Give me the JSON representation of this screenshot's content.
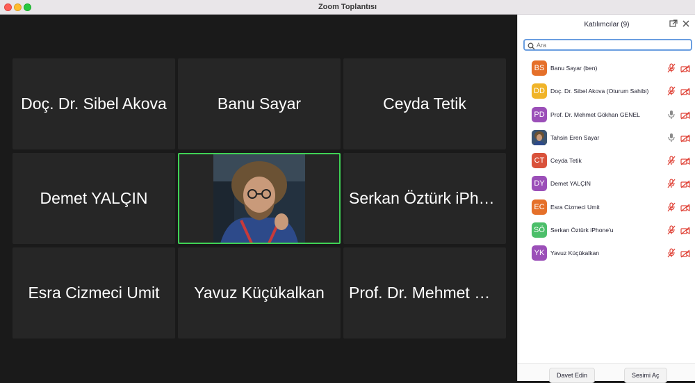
{
  "window": {
    "title": "Zoom Toplantısı"
  },
  "gallery": {
    "tiles": [
      {
        "name": "Doç. Dr. Sibel Akova"
      },
      {
        "name": "Banu Sayar"
      },
      {
        "name": "Ceyda Tetik"
      },
      {
        "name": "Demet YALÇIN"
      },
      {
        "name": "Tahsin Eren Sayar",
        "video": true,
        "active": true
      },
      {
        "name": "Serkan Öztürk iPhone'u"
      },
      {
        "name": "Esra Cizmeci Umit"
      },
      {
        "name": "Yavuz Küçükalkan"
      },
      {
        "name": "Prof. Dr. Mehmet Gökhan GENEL"
      }
    ]
  },
  "panel": {
    "title": "Katılımcılar (9)",
    "search_placeholder": "Ara",
    "participants": [
      {
        "initials": "BS",
        "name": "Banu Sayar (ben)",
        "color": "#e5702a",
        "mic": "muted",
        "cam": "off"
      },
      {
        "initials": "DD",
        "name": "Doç. Dr. Sibel Akova (Oturum Sahibi)",
        "color": "#f0b429",
        "mic": "muted",
        "cam": "off"
      },
      {
        "initials": "PD",
        "name": "Prof. Dr. Mehmet Gökhan GENEL",
        "color": "#9b4fb8",
        "mic": "unmuted",
        "cam": "off"
      },
      {
        "initials": "",
        "name": "Tahsin Eren Sayar",
        "color": "#3a5370",
        "mic": "unmuted",
        "cam": "off",
        "photo": true
      },
      {
        "initials": "CT",
        "name": "Ceyda Tetik",
        "color": "#d9523b",
        "mic": "muted",
        "cam": "off"
      },
      {
        "initials": "DY",
        "name": "Demet YALÇIN",
        "color": "#9b4fb8",
        "mic": "muted",
        "cam": "off"
      },
      {
        "initials": "EC",
        "name": "Esra Cizmeci Umit",
        "color": "#e5702a",
        "mic": "muted",
        "cam": "off"
      },
      {
        "initials": "SÖ",
        "name": "Serkan Öztürk iPhone'u",
        "color": "#4cbf6a",
        "mic": "muted",
        "cam": "off"
      },
      {
        "initials": "YK",
        "name": "Yavuz Küçükalkan",
        "color": "#9b4fb8",
        "mic": "muted",
        "cam": "off"
      }
    ],
    "footer": {
      "invite_label": "Davet Edin",
      "unmute_label": "Sesimi Aç"
    }
  },
  "colors": {
    "active_speaker_border": "#3fd255",
    "muted_icon": "#e0453a",
    "search_border": "#6a9ee0"
  }
}
